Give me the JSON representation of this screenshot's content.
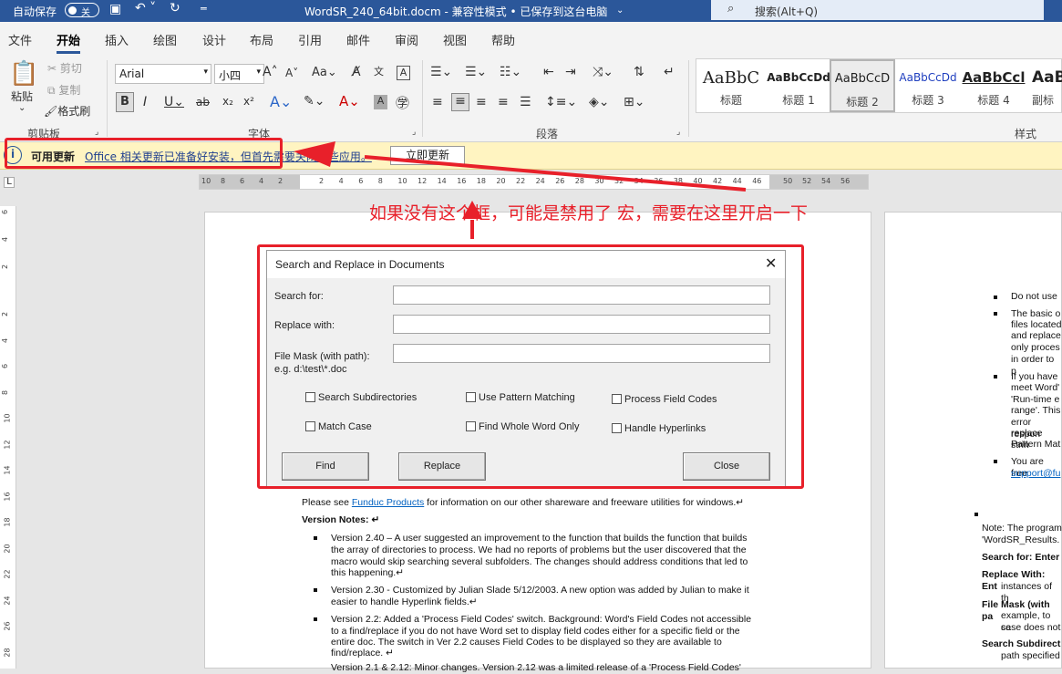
{
  "titlebar": {
    "autosave_label": "自动保存",
    "autosave_state": "关",
    "title": "WordSR_240_64bit.docm - 兼容性模式 • 已保存到这台电脑",
    "search_placeholder": "搜索(Alt+Q)"
  },
  "tabs": [
    "文件",
    "开始",
    "插入",
    "绘图",
    "设计",
    "布局",
    "引用",
    "邮件",
    "审阅",
    "视图",
    "帮助"
  ],
  "clipboard": {
    "paste": "粘贴",
    "cut": "剪切",
    "copy": "复制",
    "format_painter": "格式刷",
    "group": "剪贴板"
  },
  "font": {
    "name": "Arial",
    "size": "小四",
    "group": "字体"
  },
  "paragraph": {
    "group": "段落"
  },
  "styles": {
    "group": "样式",
    "items": [
      {
        "preview": "AaBbC",
        "name": "标题"
      },
      {
        "preview": "AaBbCcDd",
        "name": "标题 1"
      },
      {
        "preview": "AaBbCcD",
        "name": "标题 2"
      },
      {
        "preview": "AaBbCcDd",
        "name": "标题 3"
      },
      {
        "preview": "AaBbCcl",
        "name": "标题 4"
      },
      {
        "preview": "AaBl",
        "name": "副标"
      }
    ]
  },
  "message": {
    "title": "可用更新",
    "text": "Office 相关更新已准备好安装，但首先需要关闭一些应用。",
    "button": "立即更新"
  },
  "annotation": "如果没有这个框，可能是禁用了 宏，需要在这里开启一下",
  "ruler": {
    "ticks": [
      "10",
      "8",
      "6",
      "4",
      "2",
      "2",
      "4",
      "6",
      "8",
      "10",
      "12",
      "14",
      "16",
      "18",
      "20",
      "22",
      "24",
      "26",
      "28",
      "30",
      "32",
      "34",
      "36",
      "38",
      "40",
      "42",
      "44",
      "46",
      "50",
      "52",
      "54",
      "56"
    ],
    "vticks": [
      "6",
      "4",
      "2",
      "2",
      "4",
      "6",
      "8",
      "10",
      "12",
      "14",
      "16",
      "18",
      "20",
      "22",
      "24",
      "26",
      "28"
    ]
  },
  "dialog": {
    "title": "Search and Replace in Documents",
    "search_for": "Search for:",
    "replace_with": "Replace with:",
    "file_mask": "File Mask (with path):",
    "file_mask_eg": "e.g. d:\\test\\*.doc",
    "cb_subdirs": "Search Subdirectories",
    "cb_pattern": "Use Pattern Matching",
    "cb_fieldcodes": "Process Field Codes",
    "cb_matchcase": "Match Case",
    "cb_wholeword": "Find Whole Word Only",
    "cb_hyperlinks": "Handle Hyperlinks",
    "find": "Find",
    "replace": "Replace",
    "close": "Close"
  },
  "doc": {
    "please_see_pre": "Please see ",
    "link": "Funduc Products",
    "please_see_post": " for information on our other shareware and freeware utilities for windows.↵",
    "version_notes": "Version Notes: ↵",
    "v240a": "Version 2.40 – A user suggested an improvement to the function that builds the function that builds",
    "v240b": "the array of directories to process. We had no reports of problems but the user discovered that the",
    "v240c": "macro would skip searching several subfolders. The changes should address conditions that led to",
    "v240d": "this happening.↵",
    "v230a": "Version 2.30 - Customized by Julian Slade 5/12/2003. A new option was added by Julian to make it",
    "v230b": "easier to handle Hyperlink fields.↵",
    "v22a": "Version 2.2: Added a 'Process Field Codes' switch. Background: Word's Field Codes not accessible",
    "v22b": "to a find/replace if you do not have Word set to display field codes either for a specific field or the",
    "v22c": "entire doc. The switch in Ver 2.2 causes Field Codes to be displayed so they are available to",
    "v22d": "find/replace. ↵",
    "v21": "Version 2.1 & 2.12: Minor changes. Version 2.12 was a limited release of a 'Process Field Codes'"
  },
  "doc2": {
    "l1": "Do not use",
    "l2": "The basic o",
    "l3": "files located",
    "l4": "and replace",
    "l5": "only proces",
    "l6": "in order to p",
    "l7": "If you have",
    "l8": "meet Word'",
    "l9": "'Run-time e",
    "l10": "range'. This",
    "l11": "error respon",
    "l12": "replace strin",
    "l13": "Pattern Mat",
    "l14": "You are free",
    "l15": "support@fu",
    "l16": "Note: The program",
    "l17": "'WordSR_Results.",
    "l18": "Search for: Enter",
    "l19": "Replace With: Ent",
    "l20": "instances of th",
    "l21": "File Mask (with pa",
    "l22": "example, to se",
    "l23": "case does not",
    "l24": "Search Subdirect",
    "l25": "path specified"
  }
}
